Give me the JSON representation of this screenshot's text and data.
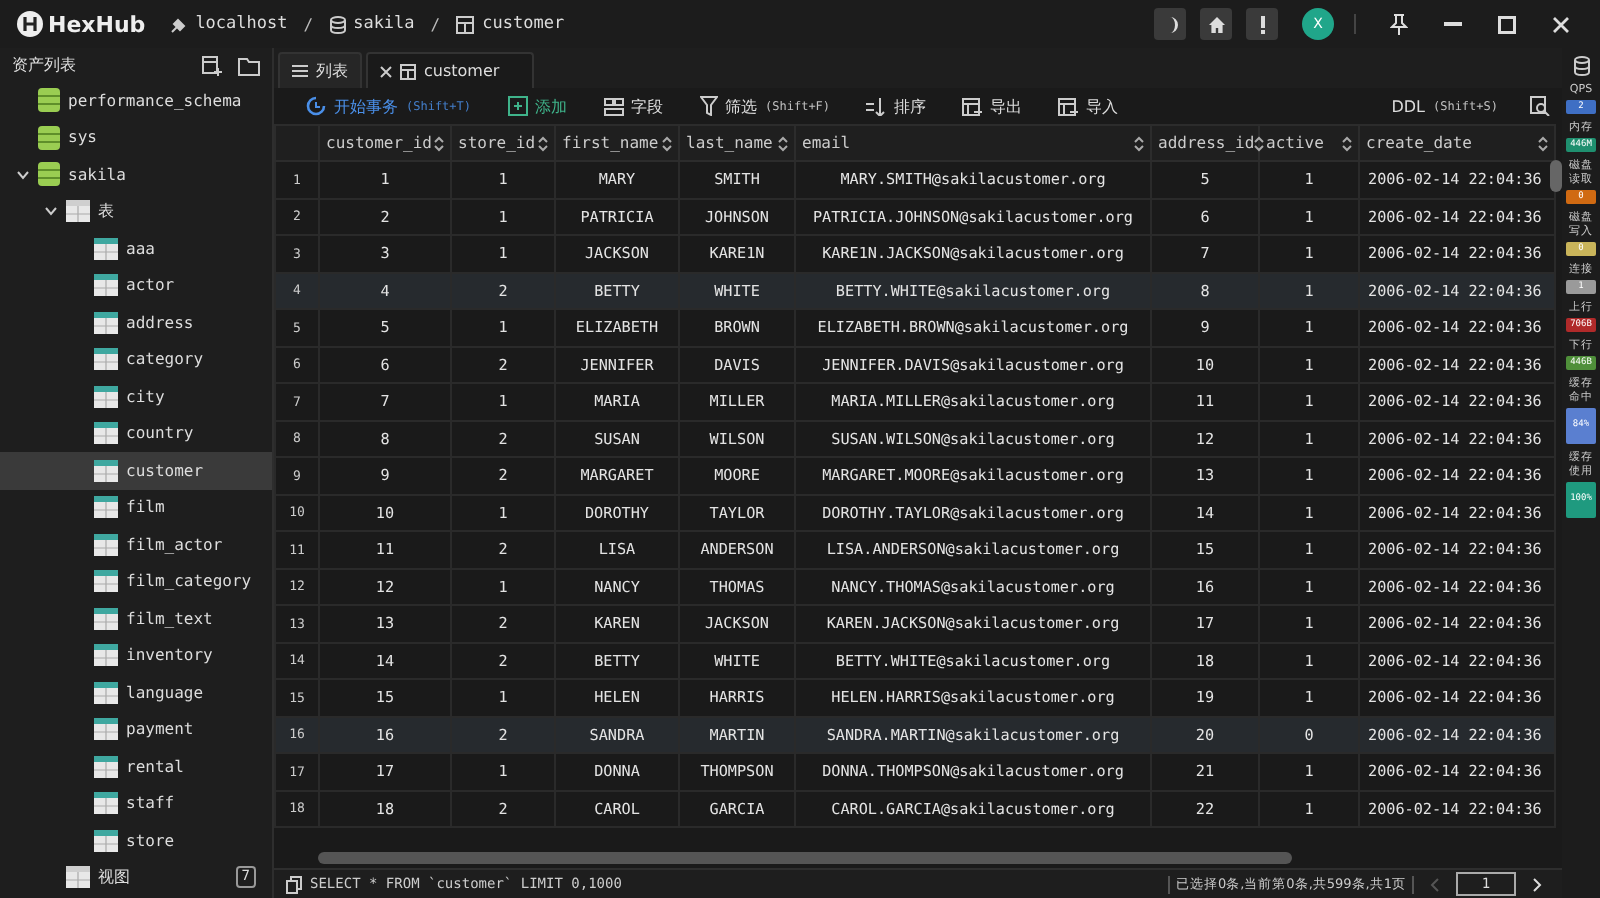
{
  "app": {
    "name": "HexHub",
    "avatar": "X"
  },
  "breadcrumb": [
    {
      "kind": "host",
      "label": "localhost"
    },
    {
      "kind": "database",
      "label": "sakila",
      "separator": "/"
    },
    {
      "kind": "table",
      "label": "customer",
      "separator": "/"
    }
  ],
  "sidebar": {
    "title": "资产列表",
    "tree": [
      {
        "kind": "database",
        "label": "performance_schema",
        "selected": false
      },
      {
        "kind": "database",
        "label": "sys",
        "selected": false
      },
      {
        "kind": "database",
        "label": "sakila",
        "expanded": true,
        "selected": false,
        "children": [
          {
            "kind": "folder",
            "label": "表",
            "expanded": true,
            "selected": false,
            "children": [
              {
                "kind": "table",
                "label": "aaa",
                "selected": false
              },
              {
                "kind": "table",
                "label": "actor",
                "selected": false
              },
              {
                "kind": "table",
                "label": "address",
                "selected": false
              },
              {
                "kind": "table",
                "label": "category",
                "selected": false
              },
              {
                "kind": "table",
                "label": "city",
                "selected": false
              },
              {
                "kind": "table",
                "label": "country",
                "selected": false
              },
              {
                "kind": "table",
                "label": "customer",
                "selected": true
              },
              {
                "kind": "table",
                "label": "film",
                "selected": false
              },
              {
                "kind": "table",
                "label": "film_actor",
                "selected": false
              },
              {
                "kind": "table",
                "label": "film_category",
                "selected": false
              },
              {
                "kind": "table",
                "label": "film_text",
                "selected": false
              },
              {
                "kind": "table",
                "label": "inventory",
                "selected": false
              },
              {
                "kind": "table",
                "label": "language",
                "selected": false
              },
              {
                "kind": "table",
                "label": "payment",
                "selected": false
              },
              {
                "kind": "table",
                "label": "rental",
                "selected": false
              },
              {
                "kind": "table",
                "label": "staff",
                "selected": false
              },
              {
                "kind": "table",
                "label": "store",
                "selected": false
              }
            ]
          },
          {
            "kind": "folder",
            "label": "视图",
            "selected": false,
            "badge": "7"
          }
        ]
      }
    ]
  },
  "tabs": [
    {
      "kind": "list",
      "label": "列表",
      "selected": false
    },
    {
      "kind": "table",
      "label": "customer",
      "selected": true
    }
  ],
  "toolbar": [
    {
      "kind": "transaction",
      "label": "开始事务",
      "shortcut": "(Shift+T)"
    },
    {
      "kind": "add",
      "label": "添加"
    },
    {
      "kind": "fields",
      "label": "字段"
    },
    {
      "kind": "filter",
      "label": "筛选",
      "shortcut": "(Shift+F)"
    },
    {
      "kind": "sort",
      "label": "排序"
    },
    {
      "kind": "export",
      "label": "导出"
    },
    {
      "kind": "import",
      "label": "导入"
    }
  ],
  "ddl": {
    "label": "DDL",
    "shortcut": "(Shift+S)"
  },
  "table": {
    "columns": [
      "customer_id",
      "store_id",
      "first_name",
      "last_name",
      "email",
      "address_id",
      "active",
      "create_date"
    ],
    "rows": [
      {
        "n": "1",
        "highlighted": false,
        "cells": [
          "1",
          "1",
          "MARY",
          "SMITH",
          "MARY.SMITH@sakilacustomer.org",
          "5",
          "1",
          "2006-02-14 22:04:36"
        ]
      },
      {
        "n": "2",
        "highlighted": false,
        "cells": [
          "2",
          "1",
          "PATRICIA",
          "JOHNSON",
          "PATRICIA.JOHNSON@sakilacustomer.org",
          "6",
          "1",
          "2006-02-14 22:04:36"
        ]
      },
      {
        "n": "3",
        "highlighted": false,
        "cells": [
          "3",
          "1",
          "JACKSON",
          "KARE1N",
          "KARE1N.JACKSON@sakilacustomer.org",
          "7",
          "1",
          "2006-02-14 22:04:36"
        ]
      },
      {
        "n": "4",
        "highlighted": true,
        "cells": [
          "4",
          "2",
          "BETTY",
          "WHITE",
          "BETTY.WHITE@sakilacustomer.org",
          "8",
          "1",
          "2006-02-14 22:04:36"
        ]
      },
      {
        "n": "5",
        "highlighted": false,
        "cells": [
          "5",
          "1",
          "ELIZABETH",
          "BROWN",
          "ELIZABETH.BROWN@sakilacustomer.org",
          "9",
          "1",
          "2006-02-14 22:04:36"
        ]
      },
      {
        "n": "6",
        "highlighted": false,
        "cells": [
          "6",
          "2",
          "JENNIFER",
          "DAVIS",
          "JENNIFER.DAVIS@sakilacustomer.org",
          "10",
          "1",
          "2006-02-14 22:04:36"
        ]
      },
      {
        "n": "7",
        "highlighted": false,
        "cells": [
          "7",
          "1",
          "MARIA",
          "MILLER",
          "MARIA.MILLER@sakilacustomer.org",
          "11",
          "1",
          "2006-02-14 22:04:36"
        ]
      },
      {
        "n": "8",
        "highlighted": false,
        "cells": [
          "8",
          "2",
          "SUSAN",
          "WILSON",
          "SUSAN.WILSON@sakilacustomer.org",
          "12",
          "1",
          "2006-02-14 22:04:36"
        ]
      },
      {
        "n": "9",
        "highlighted": false,
        "cells": [
          "9",
          "2",
          "MARGARET",
          "MOORE",
          "MARGARET.MOORE@sakilacustomer.org",
          "13",
          "1",
          "2006-02-14 22:04:36"
        ]
      },
      {
        "n": "10",
        "highlighted": false,
        "cells": [
          "10",
          "1",
          "DOROTHY",
          "TAYLOR",
          "DOROTHY.TAYLOR@sakilacustomer.org",
          "14",
          "1",
          "2006-02-14 22:04:36"
        ]
      },
      {
        "n": "11",
        "highlighted": false,
        "cells": [
          "11",
          "2",
          "LISA",
          "ANDERSON",
          "LISA.ANDERSON@sakilacustomer.org",
          "15",
          "1",
          "2006-02-14 22:04:36"
        ]
      },
      {
        "n": "12",
        "highlighted": false,
        "cells": [
          "12",
          "1",
          "NANCY",
          "THOMAS",
          "NANCY.THOMAS@sakilacustomer.org",
          "16",
          "1",
          "2006-02-14 22:04:36"
        ]
      },
      {
        "n": "13",
        "highlighted": false,
        "cells": [
          "13",
          "2",
          "KAREN",
          "JACKSON",
          "KAREN.JACKSON@sakilacustomer.org",
          "17",
          "1",
          "2006-02-14 22:04:36"
        ]
      },
      {
        "n": "14",
        "highlighted": false,
        "cells": [
          "14",
          "2",
          "BETTY",
          "WHITE",
          "BETTY.WHITE@sakilacustomer.org",
          "18",
          "1",
          "2006-02-14 22:04:36"
        ]
      },
      {
        "n": "15",
        "highlighted": false,
        "cells": [
          "15",
          "1",
          "HELEN",
          "HARRIS",
          "HELEN.HARRIS@sakilacustomer.org",
          "19",
          "1",
          "2006-02-14 22:04:36"
        ]
      },
      {
        "n": "16",
        "highlighted": true,
        "cells": [
          "16",
          "2",
          "SANDRA",
          "MARTIN",
          "SANDRA.MARTIN@sakilacustomer.org",
          "20",
          "0",
          "2006-02-14 22:04:36"
        ]
      },
      {
        "n": "17",
        "highlighted": false,
        "cells": [
          "17",
          "1",
          "DONNA",
          "THOMPSON",
          "DONNA.THOMPSON@sakilacustomer.org",
          "21",
          "1",
          "2006-02-14 22:04:36"
        ]
      },
      {
        "n": "18",
        "highlighted": false,
        "cells": [
          "18",
          "2",
          "CAROL",
          "GARCIA",
          "CAROL.GARCIA@sakilacustomer.org",
          "22",
          "1",
          "2006-02-14 22:04:36"
        ]
      }
    ]
  },
  "status_bar": {
    "query": "SELECT * FROM `customer` LIMIT 0,1000",
    "summary": "已选择0条,当前第0条,共599条,共1页",
    "page": "1"
  },
  "metrics": [
    {
      "label": "QPS",
      "value": "2",
      "color": "#3f6fc4"
    },
    {
      "label": "内存",
      "value": "446M",
      "color": "#1f8f6f"
    },
    {
      "label": "磁盘读取",
      "value": "0",
      "color": "#d06a12"
    },
    {
      "label": "磁盘写入",
      "value": "0",
      "color": "#c9b45a"
    },
    {
      "label": "连接",
      "value": "1",
      "color": "#9a9a9a"
    },
    {
      "label": "上行",
      "value": "706B",
      "color": "#b02a2a"
    },
    {
      "label": "下行",
      "value": "446B",
      "color": "#4f8f3a"
    },
    {
      "label": "缓存命中",
      "value": "84%",
      "color": "#5a7fd0"
    },
    {
      "label": "缓存使用",
      "value": "100%",
      "color": "#1f9a7f"
    }
  ]
}
